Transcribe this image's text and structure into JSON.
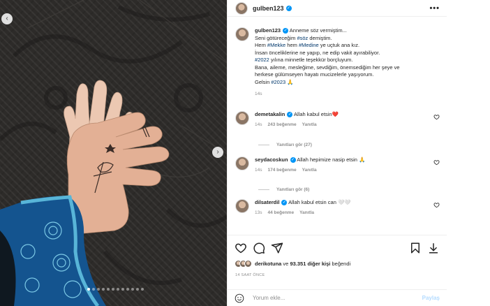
{
  "post": {
    "username": "gulben123",
    "more_label": "•••",
    "caption_lines": [
      {
        "text": "Anneme söz vermiştim..."
      },
      {
        "text": "Seni götüreceğim ",
        "tag": "#söz",
        "after": " demiştim."
      },
      {
        "text": "Hem ",
        "tag": "#Mekke",
        "after": " hem ",
        "tag2": "#Medine",
        "after2": " ye uçtuk ana kız."
      },
      {
        "text": "İnsan önceliklerine ne yapıp, ne edip vakit ayırabiliyor."
      },
      {
        "tag": "#2022",
        "after": " yılına minnetle teşekkür borçluyum."
      },
      {
        "text": "Bana, aileme, mesleğime, sevdiğim, önemsediğim her şeye ve"
      },
      {
        "text": "herkese gülümseyen hayatı mucizelerle yaşıyorum."
      },
      {
        "text": "Gelsin ",
        "tag": "#2023",
        "after": " 🙏"
      }
    ],
    "caption_age": "14s",
    "likes_prefix": "derikotuna",
    "likes_middle": " ve ",
    "likes_count": "93.351 diğer kişi",
    "likes_suffix": " beğendi",
    "time_label": "14 SAAT ÖNCE",
    "comment_placeholder": "Yorum ekle...",
    "post_button": "Paylaş",
    "colors": {
      "verified": "#0095f6",
      "hashtag": "#00376b",
      "muted": "#8e8e8e"
    }
  },
  "comments": [
    {
      "username": "demetakalin",
      "text": "Allah kabul etsin❤️",
      "age": "14s",
      "likes": "243 beğenme",
      "reply": "Yanıtla",
      "view_replies": "Yanıtları gör (27)"
    },
    {
      "username": "seydacoskun",
      "text": "Allah hepimize nasip etsin 🙏",
      "age": "14s",
      "likes": "174 beğenme",
      "reply": "Yanıtla",
      "view_replies": "Yanıtları gör (6)"
    },
    {
      "username": "dilsaterdil",
      "text": "Allah kabul etsin can 🤍🤍",
      "age": "13s",
      "likes": "44 beğenme",
      "reply": "Yanıtla"
    }
  ],
  "carousel": {
    "slides": 12,
    "active": 1
  },
  "icons": [
    "more-icon",
    "verified-icon",
    "heart-icon",
    "comment-icon",
    "share-icon",
    "bookmark-icon",
    "download-icon",
    "emoji-icon",
    "chevron-left-icon",
    "chevron-right-icon"
  ]
}
